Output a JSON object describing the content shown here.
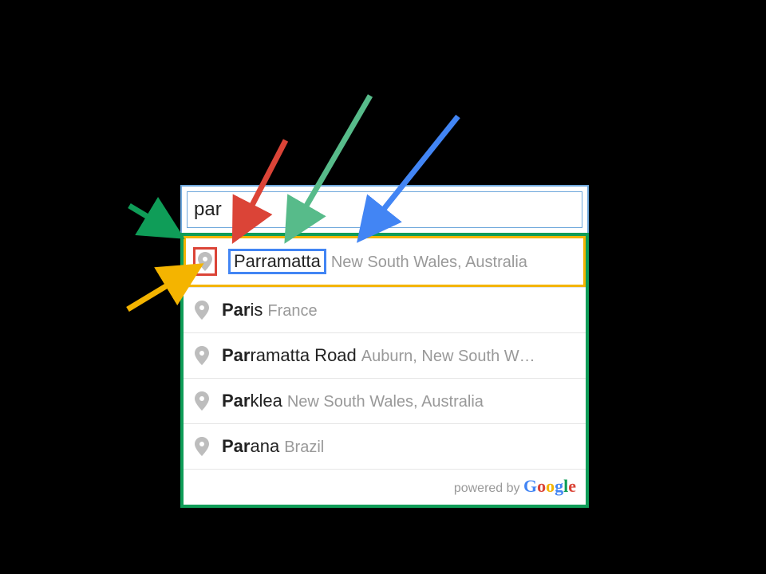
{
  "backdrop": {
    "color": "#000"
  },
  "search": {
    "value": "par",
    "placeholder": ""
  },
  "annotation_boxes": {
    "dropdown_border_color": "#0f9d58",
    "highlight_row_color": "#f4b400",
    "pin_box_color": "#db4437",
    "main_term_box_color": "#4285f4"
  },
  "arrows": [
    {
      "name": "arrow-green-dark",
      "color": "#0f9d58",
      "target": "dropdown"
    },
    {
      "name": "arrow-orange",
      "color": "#f4b400",
      "target": "highlighted-row"
    },
    {
      "name": "arrow-red",
      "color": "#db4437",
      "target": "pin-box"
    },
    {
      "name": "arrow-green-light",
      "color": "#57bb8a",
      "target": "matched-text"
    },
    {
      "name": "arrow-blue",
      "color": "#4285f4",
      "target": "main-term-box"
    }
  ],
  "suggestions": [
    {
      "matched": "Par",
      "rest": "ramatta",
      "desc": "New South Wales, Australia",
      "highlighted": true
    },
    {
      "matched": "Par",
      "rest": "is",
      "desc": "France",
      "highlighted": false
    },
    {
      "matched": "Par",
      "rest": "ramatta Road",
      "desc": "Auburn, New South W",
      "highlighted": false,
      "truncated": true
    },
    {
      "matched": "Par",
      "rest": "klea",
      "desc": "New South Wales, Australia",
      "highlighted": false
    },
    {
      "matched": "Par",
      "rest": "ana",
      "desc": "Brazil",
      "highlighted": false
    }
  ],
  "footer": {
    "prefix": "powered by ",
    "logo_letters": [
      "G",
      "o",
      "o",
      "g",
      "l",
      "e"
    ]
  }
}
